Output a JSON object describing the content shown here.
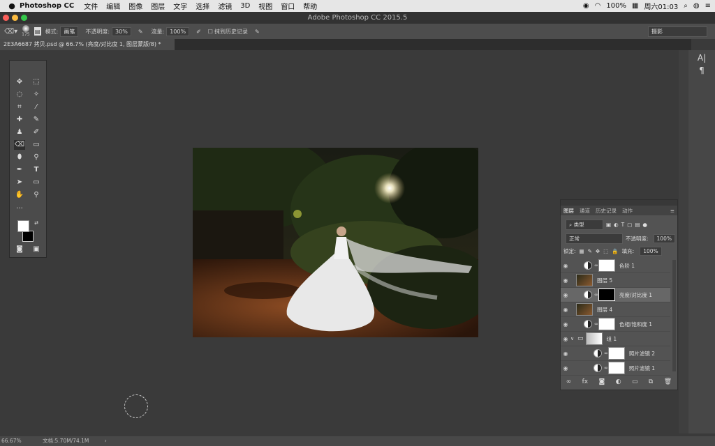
{
  "menubar": {
    "apple": "",
    "app": "Photoshop CC",
    "items": [
      "文件",
      "编辑",
      "图像",
      "图层",
      "文字",
      "选择",
      "滤镜",
      "3D",
      "视图",
      "窗口",
      "帮助"
    ],
    "battery": "100%",
    "clock": "周六01:03"
  },
  "window": {
    "title": "Adobe Photoshop CC 2015.5"
  },
  "options": {
    "brush_size": "175",
    "mode_label": "模式:",
    "mode_value": "画笔",
    "opacity_label": "不透明度:",
    "opacity_value": "30%",
    "flow_label": "流量:",
    "flow_value": "100%",
    "erase_history": "抹到历史记录",
    "workspace": "摄影"
  },
  "document": {
    "tab": "2E3A6687 拷贝.psd @ 66.7% (亮度/对比度 1, 图层蒙版/8) *"
  },
  "layers_panel": {
    "tabs": [
      "图层",
      "通道",
      "历史记录",
      "动作"
    ],
    "kind": "类型",
    "blend": "正常",
    "opacity_label": "不透明度:",
    "opacity": "100%",
    "lock_label": "锁定:",
    "fill_label": "填充:",
    "fill": "100%",
    "layers": [
      {
        "name": "色阶 1",
        "type": "adjustment",
        "mask": "white"
      },
      {
        "name": "图层 5",
        "type": "image"
      },
      {
        "name": "亮度/对比度 1",
        "type": "adjustment",
        "mask": "black",
        "selected": true
      },
      {
        "name": "图层 4",
        "type": "image"
      },
      {
        "name": "色相/饱和度 1",
        "type": "adjustment",
        "mask": "white"
      },
      {
        "name": "组 1",
        "type": "group"
      },
      {
        "name": "照片滤镜 2",
        "type": "adjustment",
        "mask": "white"
      },
      {
        "name": "照片滤镜 1",
        "type": "adjustment",
        "mask": "white"
      }
    ]
  },
  "status": {
    "zoom": "66.67%",
    "doc": "文档:5.70M/74.1M"
  },
  "right_dock": {
    "char_icon": "A|",
    "para_icon": "¶"
  }
}
